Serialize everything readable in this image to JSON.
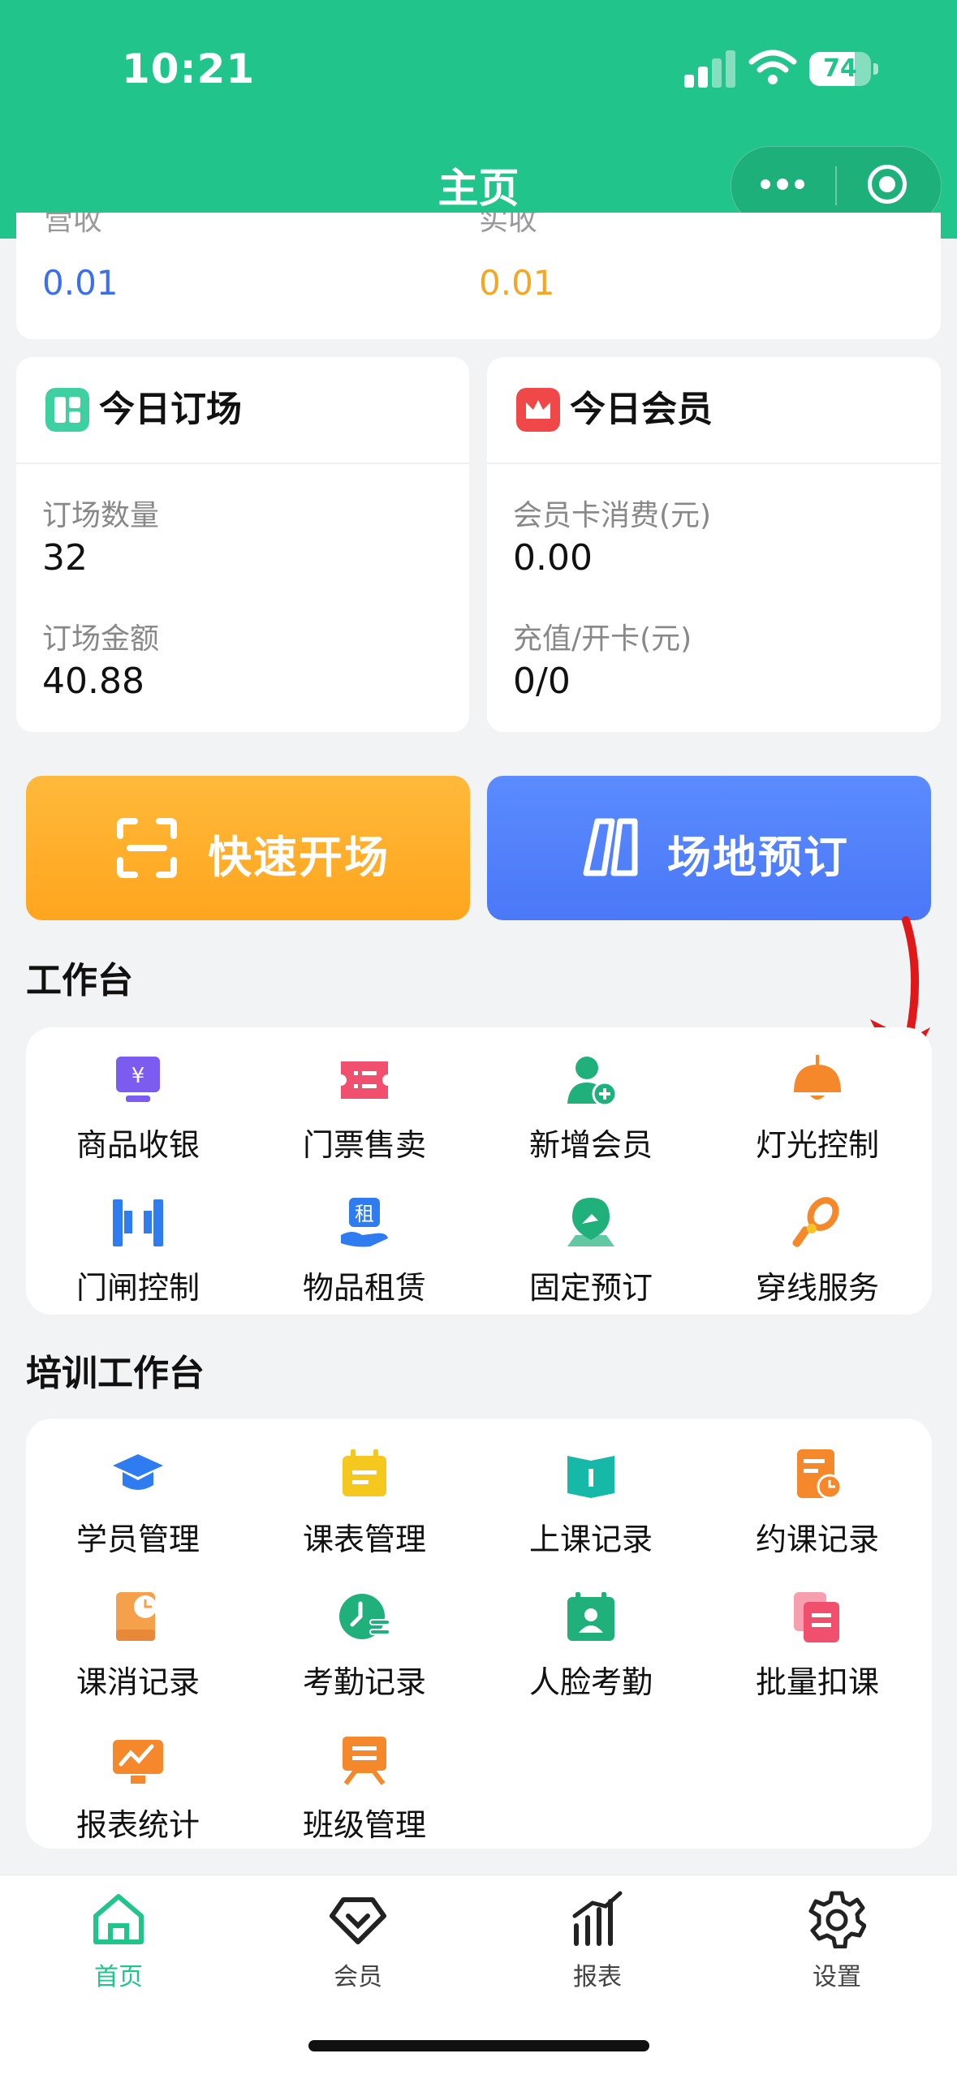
{
  "status": {
    "time": "10:21",
    "battery": "74",
    "battery_level": 0.74
  },
  "nav": {
    "title": "主页"
  },
  "revenue": {
    "left_label": "营收",
    "left_value": "0.01",
    "right_label": "实收",
    "right_value": "0.01"
  },
  "today_booking": {
    "title": "今日订场",
    "count_label": "订场数量",
    "count_value": "32",
    "amount_label": "订场金额",
    "amount_value": "40.88"
  },
  "today_member": {
    "title": "今日会员",
    "spend_label": "会员卡消费(元)",
    "spend_value": "0.00",
    "recharge_label": "充值/开卡(元)",
    "recharge_value": "0/0"
  },
  "actions": {
    "quick_open": "快速开场",
    "venue_booking": "场地预订"
  },
  "workbench": {
    "title": "工作台",
    "items": [
      {
        "label": "商品收银",
        "icon": "cash-register-icon"
      },
      {
        "label": "门票售卖",
        "icon": "ticket-icon"
      },
      {
        "label": "新增会员",
        "icon": "add-member-icon"
      },
      {
        "label": "灯光控制",
        "icon": "light-icon"
      },
      {
        "label": "门闸控制",
        "icon": "gate-icon"
      },
      {
        "label": "物品租赁",
        "icon": "rental-icon"
      },
      {
        "label": "固定预订",
        "icon": "pin-icon"
      },
      {
        "label": "穿线服务",
        "icon": "stringing-icon"
      }
    ]
  },
  "training": {
    "title": "培训工作台",
    "items": [
      {
        "label": "学员管理",
        "icon": "graduation-cap-icon"
      },
      {
        "label": "课表管理",
        "icon": "schedule-icon"
      },
      {
        "label": "上课记录",
        "icon": "book-icon"
      },
      {
        "label": "约课记录",
        "icon": "appointment-icon"
      },
      {
        "label": "课消记录",
        "icon": "class-consume-icon"
      },
      {
        "label": "考勤记录",
        "icon": "attendance-icon"
      },
      {
        "label": "人脸考勤",
        "icon": "face-id-icon"
      },
      {
        "label": "批量扣课",
        "icon": "batch-deduct-icon"
      },
      {
        "label": "报表统计",
        "icon": "report-chart-icon"
      },
      {
        "label": "班级管理",
        "icon": "class-manage-icon"
      }
    ]
  },
  "tabbar": {
    "items": [
      {
        "label": "首页",
        "icon": "home-icon"
      },
      {
        "label": "会员",
        "icon": "member-icon"
      },
      {
        "label": "报表",
        "icon": "report-icon"
      },
      {
        "label": "设置",
        "icon": "settings-icon"
      }
    ]
  },
  "colors": {
    "brand": "#21c48a",
    "blue_value": "#3b6ff0",
    "orange_value": "#f5a623",
    "orange_button": "#ffad2a",
    "blue_button": "#4d7cff",
    "annotation_arrow": "#e01818"
  }
}
